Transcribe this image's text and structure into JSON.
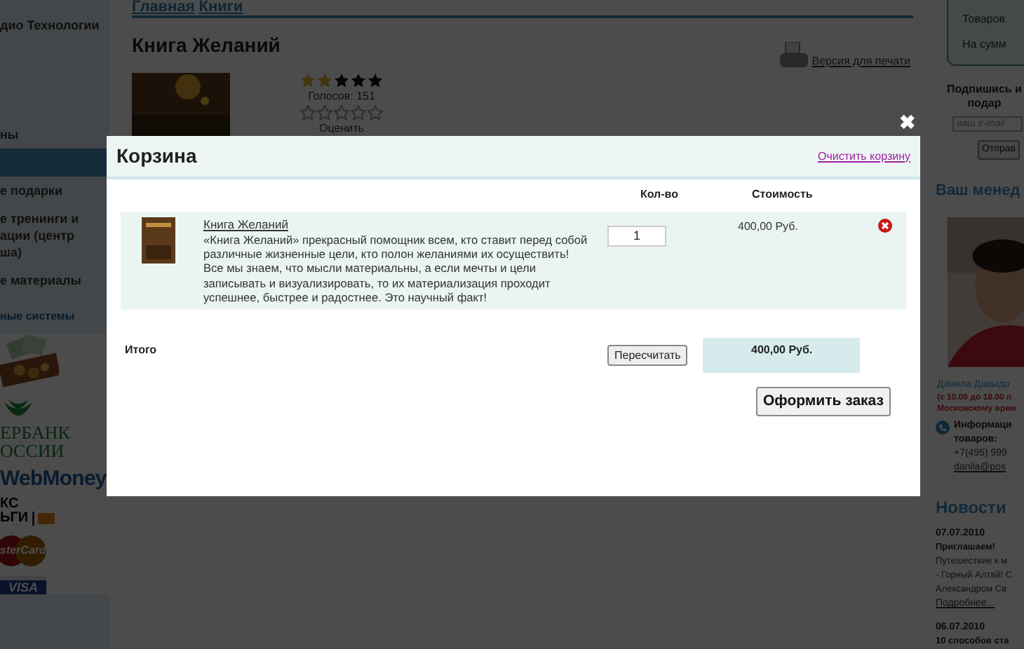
{
  "left_sidebar": {
    "header": "дио Технологии",
    "items": [
      {
        "lines": [
          "ны"
        ],
        "selected": false
      },
      {
        "selected": true
      },
      {
        "lines": [
          "е подарки"
        ],
        "selected": false
      },
      {
        "lines": [
          "е тренинги и",
          "ации (центр",
          "ша)"
        ],
        "selected": false
      },
      {
        "lines": [
          "е материалы"
        ],
        "selected": false
      }
    ],
    "payments_title": "ные системы",
    "payment_logos": [
      {
        "kind": "picture"
      },
      {
        "kind": "sber",
        "lines": [
          "ЕРБАНК",
          "ОССИИ"
        ]
      },
      {
        "kind": "webmoney",
        "text": "WebMoney"
      },
      {
        "kind": "yandex",
        "lines": [
          "КС",
          "ЬГИ"
        ]
      },
      {
        "kind": "mastercard",
        "text": "sterCard"
      },
      {
        "kind": "visa",
        "text": "VISA"
      }
    ]
  },
  "breadcrumb": [
    "Главная",
    "Книги"
  ],
  "product": {
    "title": "Книга Желаний",
    "rating": {
      "stars": 2
    },
    "votes": "Голосов: 151",
    "vote": {
      "stars": 0
    },
    "vote_label": "Оценить",
    "print_link": "Версия для печати"
  },
  "right_sidebar": {
    "cart_box": [
      "Товаров",
      "На сумм"
    ],
    "subscribe_title": [
      "Подпишись и",
      "подар"
    ],
    "email_placeholder": "ваш e-mail",
    "send_button": "Отправ",
    "manager_title": "Ваш менед",
    "manager_name": "Данила Давыдо",
    "hours": [
      "(с 10.00 до 18.00 п",
      "Московскому врем"
    ],
    "info": [
      "Информаци",
      "товаров:"
    ],
    "phone": "+7(495) 999",
    "email": "danila@pos",
    "news_title": "Новости",
    "news": [
      {
        "date": "07.07.2010",
        "title": "Приглашаем!",
        "text": [
          "Путешествие к м",
          "- Горный Алтай! С",
          "Александром Св"
        ],
        "more": "Подробнее..."
      },
      {
        "date": "06.07.2010",
        "title": "10 способов ста"
      }
    ]
  },
  "cart_dialog": {
    "title": "Корзина",
    "clear_link": "Очистить корзину",
    "close": "✖",
    "columns": [
      "Кол-во",
      "Стоимость"
    ],
    "items": [
      {
        "name": "Книга Желаний",
        "description": "«Книга Желаний» прекрасный помощник всем, кто ставит перед собой различные жизненные цели, кто полон желаниями их осуществить! Все мы знаем, что мысли материальны, а если мечты и цели записывать и визуализировать, то их материализация проходит успешнее, быстрее и радостнее. Это научный факт!",
        "quantity": "1",
        "price": "400,00 Руб."
      }
    ],
    "total_label": "Итого",
    "recalc_button": "Пересчитать",
    "total": "400,00 Руб.",
    "order_button": "Оформить заказ"
  }
}
